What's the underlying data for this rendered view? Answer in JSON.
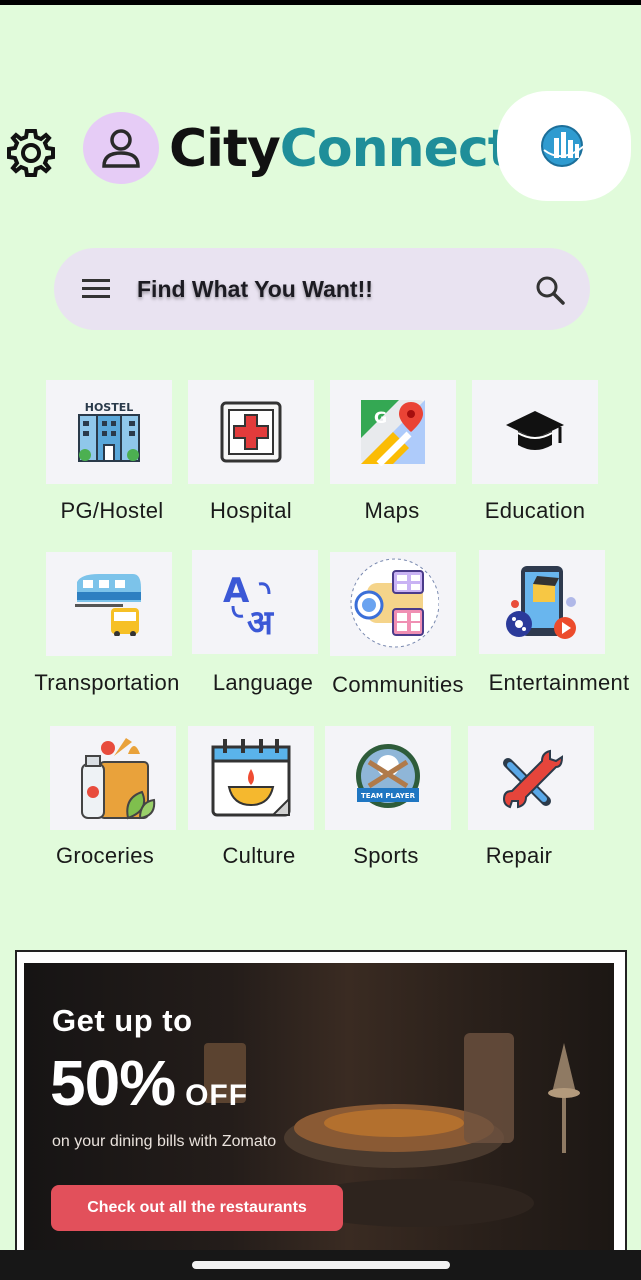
{
  "header": {
    "brand_part1": "City",
    "brand_part2": "Connect"
  },
  "search": {
    "placeholder": "Find What You Want!!"
  },
  "categories": [
    {
      "label": "PG/Hostel",
      "icon": "hostel-icon"
    },
    {
      "label": "Hospital",
      "icon": "hospital-icon"
    },
    {
      "label": "Maps",
      "icon": "maps-icon"
    },
    {
      "label": "Education",
      "icon": "education-icon"
    },
    {
      "label": "Transportation",
      "icon": "transportation-icon"
    },
    {
      "label": "Language",
      "icon": "language-icon"
    },
    {
      "label": "Communities",
      "icon": "communities-icon"
    },
    {
      "label": "Entertainment",
      "icon": "entertainment-icon"
    },
    {
      "label": "Groceries",
      "icon": "groceries-icon"
    },
    {
      "label": "Culture",
      "icon": "culture-icon"
    },
    {
      "label": "Sports",
      "icon": "sports-icon"
    },
    {
      "label": "Repair",
      "icon": "repair-icon"
    }
  ],
  "icon_text": {
    "hostel_sign": "HOSTEL",
    "maps_letter": "G",
    "language_a": "A",
    "language_hindi": "अ",
    "sports_badge": "TEAM PLAYER"
  },
  "promo": {
    "line1": "Get up to",
    "percent": "50%",
    "off": "OFF",
    "subtitle": "on your dining bills with Zomato",
    "button": "Check out all the restaurants"
  },
  "colors": {
    "background": "#e1fbdb",
    "brand_accent": "#1f8e99",
    "search_bg": "#e9e3f1",
    "promo_button": "#e2505b"
  }
}
